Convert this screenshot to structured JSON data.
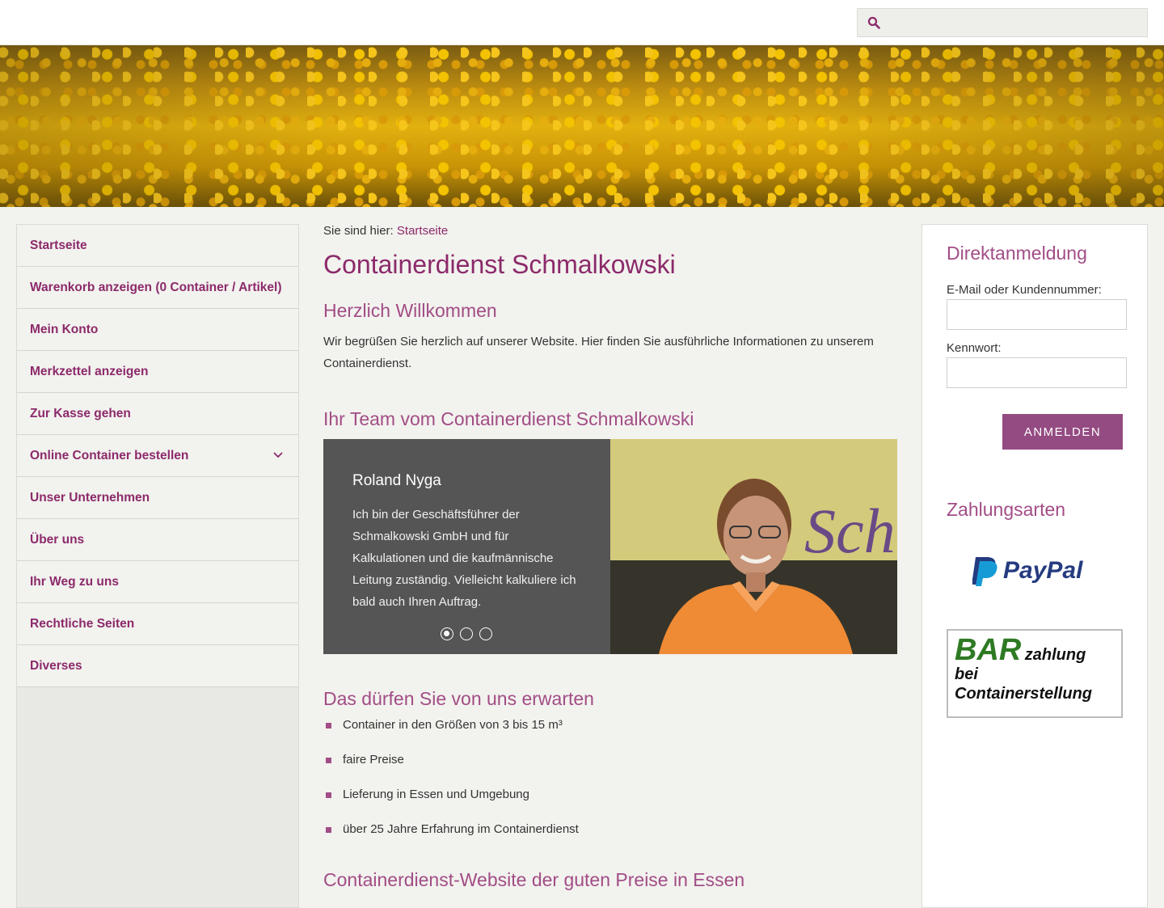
{
  "header": {
    "search": {
      "placeholder": "",
      "value": ""
    }
  },
  "sidebar": {
    "items": [
      {
        "label": "Startseite"
      },
      {
        "label": "Warenkorb anzeigen (0 Container / Artikel)"
      },
      {
        "label": "Mein Konto"
      },
      {
        "label": "Merkzettel anzeigen"
      },
      {
        "label": "Zur Kasse gehen"
      },
      {
        "label": "Online Container bestellen",
        "has_submenu": true
      },
      {
        "label": "Unser Unternehmen"
      },
      {
        "label": "Über uns"
      },
      {
        "label": "Ihr Weg zu uns"
      },
      {
        "label": "Rechtliche Seiten"
      },
      {
        "label": "Diverses"
      }
    ]
  },
  "main": {
    "breadcrumb_prefix": "Sie sind hier:",
    "breadcrumb_link": "Startseite",
    "title": "Containerdienst Schmalkowski",
    "welcome_heading": "Herzlich Willkommen",
    "welcome_text": "Wir begrüßen Sie herzlich auf unserer Website. Hier finden Sie ausführliche Informationen zu unserem Containerdienst.",
    "team_heading": "Ihr Team vom Containerdienst Schmalkowski",
    "slider": {
      "name": "Roland Nyga",
      "description": "Ich bin der Geschäftsführer der Schmalkowski GmbH und für Kalkulationen und die kaufmännische Leitung zuständig. Vielleicht kalkuliere ich bald auch Ihren Auftrag.",
      "photo_text": "Schm",
      "slide_count": 3,
      "active_slide": 1
    },
    "expect_heading": "Das dürfen Sie von uns erwarten",
    "features": [
      "Container in den Größen von 3 bis 15 m³",
      "faire Preise",
      "Lieferung in Essen und Umgebung",
      "über 25 Jahre Erfahrung im Containerdienst"
    ],
    "bottom_heading": "Containerdienst-Website der guten Preise in Essen"
  },
  "login": {
    "heading": "Direktanmeldung",
    "email_label": "E-Mail oder Kundennummer:",
    "password_label": "Kennwort:",
    "submit_label": "ANMELDEN"
  },
  "payment": {
    "heading": "Zahlungsarten",
    "paypal_text": "PayPal",
    "cash_big": "BAR",
    "cash_small": "zahlung",
    "cash_line2": "bei",
    "cash_line3": "Containerstellung"
  },
  "colors": {
    "accent": "#8c2a6b",
    "heading": "#a24d86",
    "button": "#944b82",
    "slide_bg": "#555555",
    "page_bg": "#f2f2ee"
  }
}
